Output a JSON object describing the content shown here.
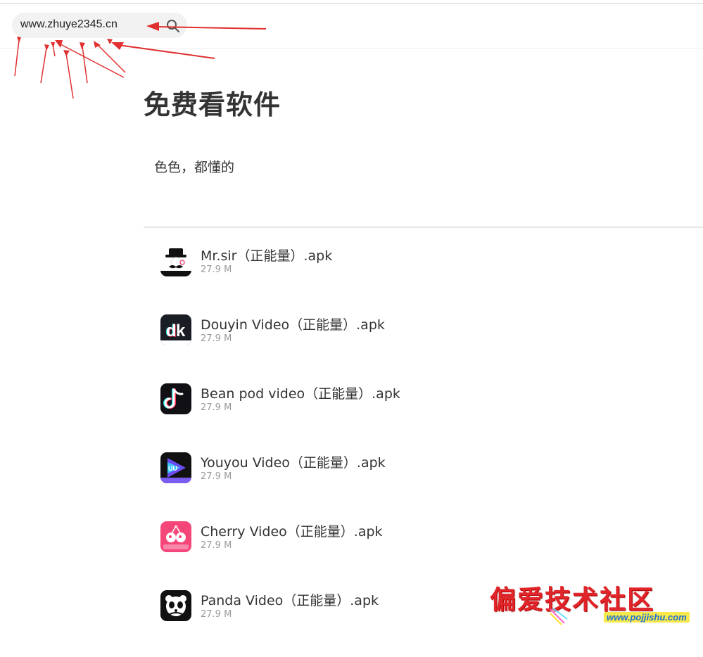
{
  "search": {
    "value": "www.zhuye2345.cn"
  },
  "page": {
    "title": "免费看软件",
    "description": "色色，都懂的"
  },
  "files": [
    {
      "name": "Mr.sir（正能量）.apk",
      "size": "27.9 M",
      "icon": "mr-sir-app-icon"
    },
    {
      "name": "Douyin Video（正能量）.apk",
      "size": "27.9 M",
      "icon": "douyin-app-icon"
    },
    {
      "name": "Bean pod video（正能量）.apk",
      "size": "27.9 M",
      "icon": "bean-pod-app-icon"
    },
    {
      "name": "Youyou Video（正能量）.apk",
      "size": "27.9 M",
      "icon": "youyou-app-icon"
    },
    {
      "name": "Cherry Video（正能量）.apk",
      "size": "27.9 M",
      "icon": "cherry-app-icon"
    },
    {
      "name": "Panda Video（正能量）.apk",
      "size": "27.9 M",
      "icon": "panda-app-icon"
    }
  ],
  "watermark": {
    "title": "偏爱技术社区",
    "url": "www.pojjishu.com"
  },
  "colors": {
    "annotation_arrow": "#e03030",
    "watermark_red": "#e0262b",
    "watermark_blue": "#1f6fd6"
  }
}
